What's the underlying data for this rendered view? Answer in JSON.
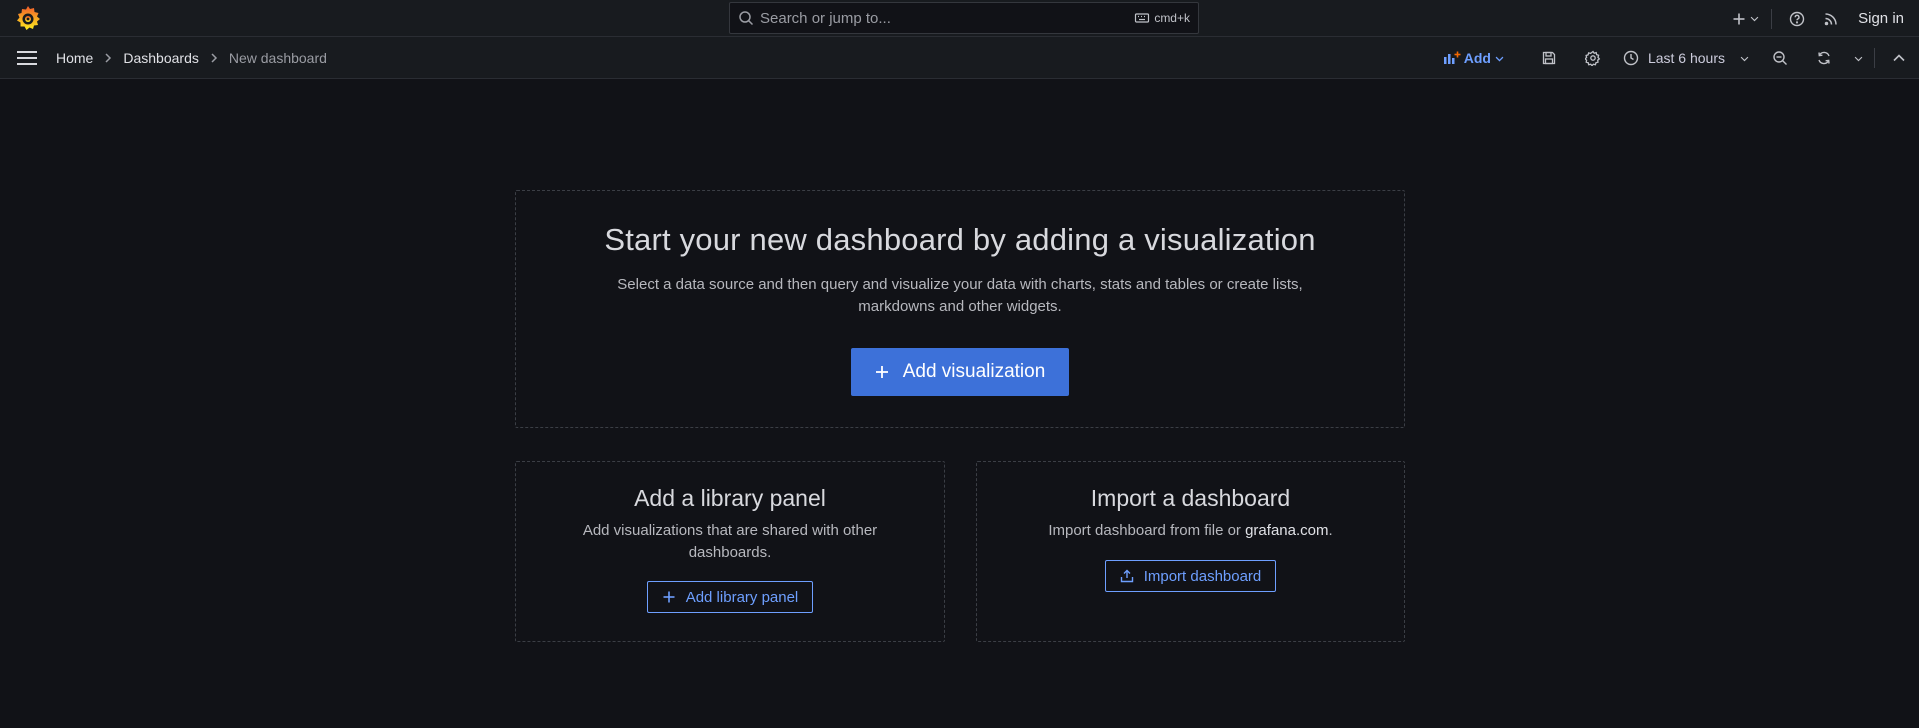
{
  "topbar": {
    "search_placeholder": "Search or jump to...",
    "search_shortcut": "cmd+k",
    "sign_in": "Sign in"
  },
  "subbar": {
    "breadcrumbs": [
      "Home",
      "Dashboards",
      "New dashboard"
    ],
    "add_label": "Add",
    "time_range": "Last 6 hours"
  },
  "main_panel": {
    "title": "Start your new dashboard by adding a visualization",
    "description": "Select a data source and then query and visualize your data with charts, stats and tables or create lists, markdowns and other widgets.",
    "button": "Add visualization"
  },
  "library_panel": {
    "title": "Add a library panel",
    "description": "Add visualizations that are shared with other dashboards.",
    "button": "Add library panel"
  },
  "import_panel": {
    "title": "Import a dashboard",
    "description_prefix": "Import dashboard from file or ",
    "link": "grafana.com",
    "description_suffix": ".",
    "button": "Import dashboard"
  },
  "colors": {
    "background": "#111217",
    "bar": "#181b1f",
    "primary": "#3d71d9",
    "accent": "#6e9fff",
    "logo_orange": "#f46800"
  },
  "icons": [
    "grafana-logo-icon",
    "search-icon",
    "keyboard-icon",
    "plus-icon",
    "chevron-down-icon",
    "help-icon",
    "rss-icon",
    "menu-icon",
    "chevron-right-icon",
    "add-panel-icon",
    "save-icon",
    "gear-icon",
    "clock-icon",
    "zoom-out-icon",
    "refresh-icon",
    "chevron-up-icon",
    "upload-icon"
  ]
}
